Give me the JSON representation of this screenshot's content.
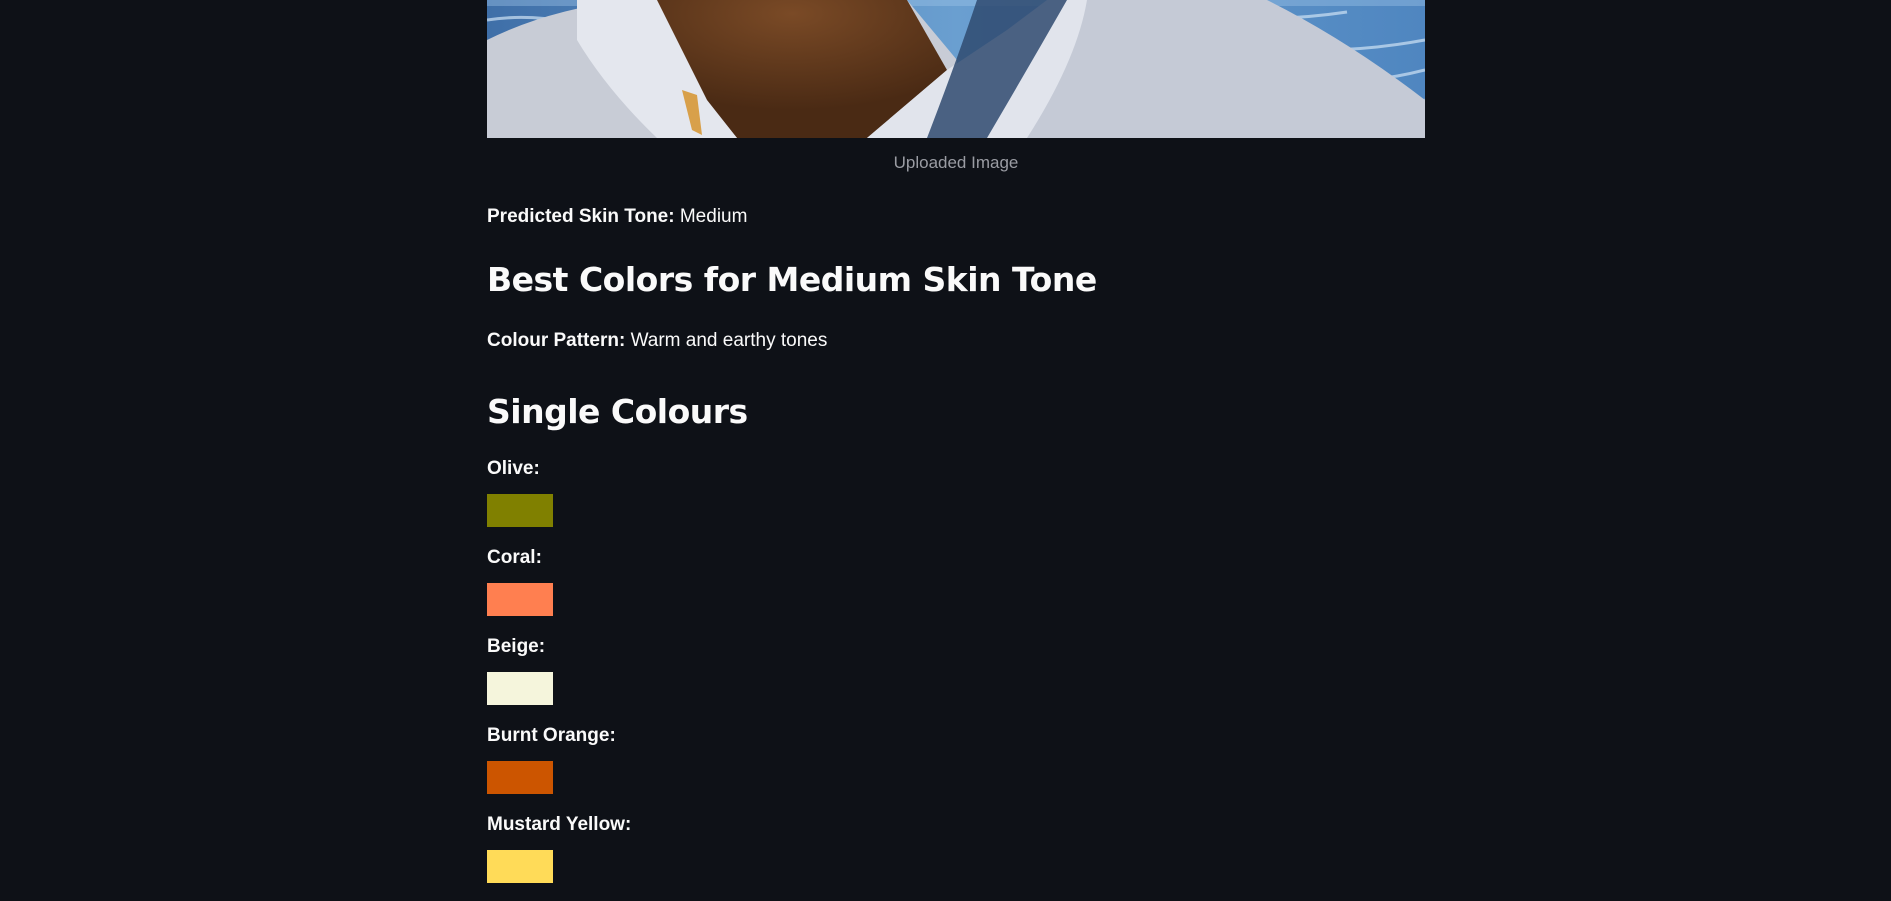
{
  "image": {
    "caption": "Uploaded Image"
  },
  "prediction": {
    "label": "Predicted Skin Tone:",
    "value": "Medium"
  },
  "best_colors": {
    "heading": "Best Colors for Medium Skin Tone",
    "pattern_label": "Colour Pattern:",
    "pattern_value": "Warm and earthy tones"
  },
  "single_colours": {
    "heading": "Single Colours",
    "items": [
      {
        "label": "Olive:",
        "color": "#808000"
      },
      {
        "label": "Coral:",
        "color": "#ff7f50"
      },
      {
        "label": "Beige:",
        "color": "#f5f5dc"
      },
      {
        "label": "Burnt Orange:",
        "color": "#cc5500"
      },
      {
        "label": "Mustard Yellow:",
        "color": "#ffdb58"
      }
    ]
  },
  "colors": {
    "background": "#0e1117",
    "text": "#fafafa",
    "caption": "#9a9ca3"
  }
}
